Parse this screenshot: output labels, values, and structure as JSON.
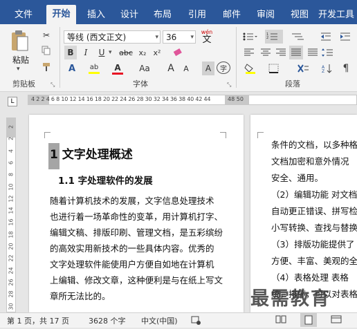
{
  "tabs": [
    "文件",
    "开始",
    "插入",
    "设计",
    "布局",
    "引用",
    "邮件",
    "审阅",
    "视图",
    "开发工具"
  ],
  "clipboard": {
    "paste_label": "粘贴",
    "group_label": "剪贴板"
  },
  "font": {
    "font_name": "等线 (西文正文)",
    "font_size": "36",
    "group_label": "字体",
    "wen_glyph": "wén",
    "wen_char": "文",
    "bold": "B",
    "italic": "I",
    "underline": "U",
    "strike": "abc",
    "subscript": "x₂",
    "superscript": "x²",
    "font_color": "A",
    "case": "Aa",
    "grow": "A",
    "shrink": "A",
    "char_border": "A",
    "char_shade": "A",
    "phonetic": "字",
    "enclose": "字",
    "highlight": "ab"
  },
  "paragraph": {
    "group_label": "段落"
  },
  "ruler": {
    "marks": "4 2  2 4 6 8 10 12 14 16 18 20 22 24 26 28 30 32 34 36 38 40 42 44",
    "end": "48 50",
    "left_marker": "L"
  },
  "vruler_numbers": [
    "2",
    "2",
    "4",
    "6",
    "8",
    "10",
    "12",
    "14",
    "16",
    "18",
    "20",
    "22",
    "24",
    "26",
    "28",
    "30"
  ],
  "page1": {
    "heading1": "1 文字处理概述",
    "heading2": "1.1  字处理软件的发展",
    "lines": [
      "随着计算机技术的发展，文字信息处理技术",
      "也进行着一场革命性的变革，用计算机打字、",
      "编辑文稿、排版印刷、管理文档，是五彩缤纷",
      "的高效实用新技术的一些具体内容。优秀的",
      "文字处理软件能使用户方便自如地在计算机",
      "上编辑、修改文章，这种便利是与在纸上写文",
      "章所无法比的。"
    ]
  },
  "page2": {
    "lines": [
      "条件的文档，以多种格",
      "文档加密和意外情况",
      "安全、通用。",
      "（2）编辑功能 对文档",
      "自动更正错误、拼写检",
      "小写转换、查找与替换",
      "（3）排版功能提供了",
      "方便、丰富、美观的全",
      "（4）表格处理  表格",
      "统，排序，可以对表格"
    ]
  },
  "watermark": "最需教育",
  "status": {
    "page": "第 1 页，共 17 页",
    "words": "3628 个字",
    "lang": "中文(中国)"
  },
  "colors": {
    "brand": "#2b579a",
    "font_color_bar": "#e81123",
    "highlight_bar": "#ffff00"
  }
}
